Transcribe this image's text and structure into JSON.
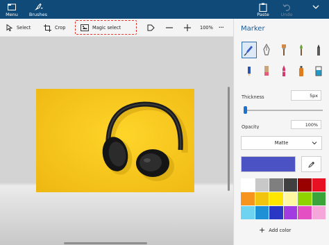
{
  "topbar": {
    "menu_label": "Menu",
    "brushes_label": "Brushes",
    "paste_label": "Paste",
    "undo_label": "Undo"
  },
  "toolbar": {
    "select_label": "Select",
    "crop_label": "Crop",
    "magic_select_label": "Magic select",
    "zoom": "100%",
    "more": "···"
  },
  "panel": {
    "title": "Marker",
    "thickness_label": "Thickness",
    "thickness_value": "5px",
    "thickness_fraction": 0.02,
    "opacity_label": "Opacity",
    "opacity_value": "100%",
    "texture": "Matte",
    "current_color": "#4b52c4",
    "add_color_label": "Add color",
    "brushes": [
      {
        "name": "marker-brush-icon",
        "color": "#3a5ac0"
      },
      {
        "name": "calligraphy-pen-icon",
        "color": "#6b6b6b"
      },
      {
        "name": "oil-brush-icon",
        "color": "#d28a46"
      },
      {
        "name": "watercolor-icon",
        "color": "#6e9f3c"
      },
      {
        "name": "pixel-pen-icon",
        "color": "#3a3a3a"
      },
      {
        "name": "pencil-icon",
        "color": "#2d55b0"
      },
      {
        "name": "eraser-icon",
        "color": "#c8a57d"
      },
      {
        "name": "crayon-icon",
        "color": "#d13a6b"
      },
      {
        "name": "spray-can-icon",
        "color": "#e07b1e"
      },
      {
        "name": "fill-icon",
        "color": "#1f9ac9"
      }
    ],
    "palette": [
      "#ffffff",
      "#c8c8c8",
      "#7f7f7f",
      "#404040",
      "#990000",
      "#e81123",
      "#f7941d",
      "#f2c40f",
      "#ffe600",
      "#fff8a0",
      "#8fd400",
      "#3aa33a",
      "#6ed3f0",
      "#1e90d6",
      "#2a36c4",
      "#a23be0",
      "#e54fc4",
      "#f4a7d8"
    ]
  }
}
